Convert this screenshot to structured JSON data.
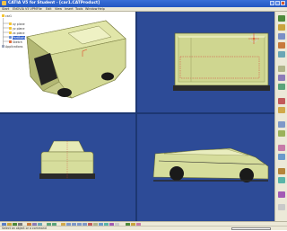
{
  "titlebar": {
    "title": "CATIA V5 for Student - [car1.CATProduct]"
  },
  "menubar": {
    "items": [
      "Start",
      "ENOVIA V5 VPM",
      "File",
      "Edit",
      "View",
      "Insert",
      "Tools",
      "Window",
      "Help"
    ]
  },
  "tree": {
    "nodes": [
      {
        "label": "car1",
        "selected": false
      },
      {
        "label": "xy plane",
        "selected": false
      },
      {
        "label": "yz plane",
        "selected": false
      },
      {
        "label": "zx plane",
        "selected": false
      },
      {
        "label": "PartBody",
        "selected": true
      },
      {
        "label": "Sketch",
        "selected": false
      },
      {
        "label": "Applications",
        "selected": false
      }
    ]
  },
  "statusbar": {
    "text": "Select an object or a command"
  },
  "colors": {
    "titlebar": "#2457c2",
    "viewport_bg": "#2d4b97",
    "model": "#d6dd9c",
    "selection": "#2e5ec9"
  }
}
